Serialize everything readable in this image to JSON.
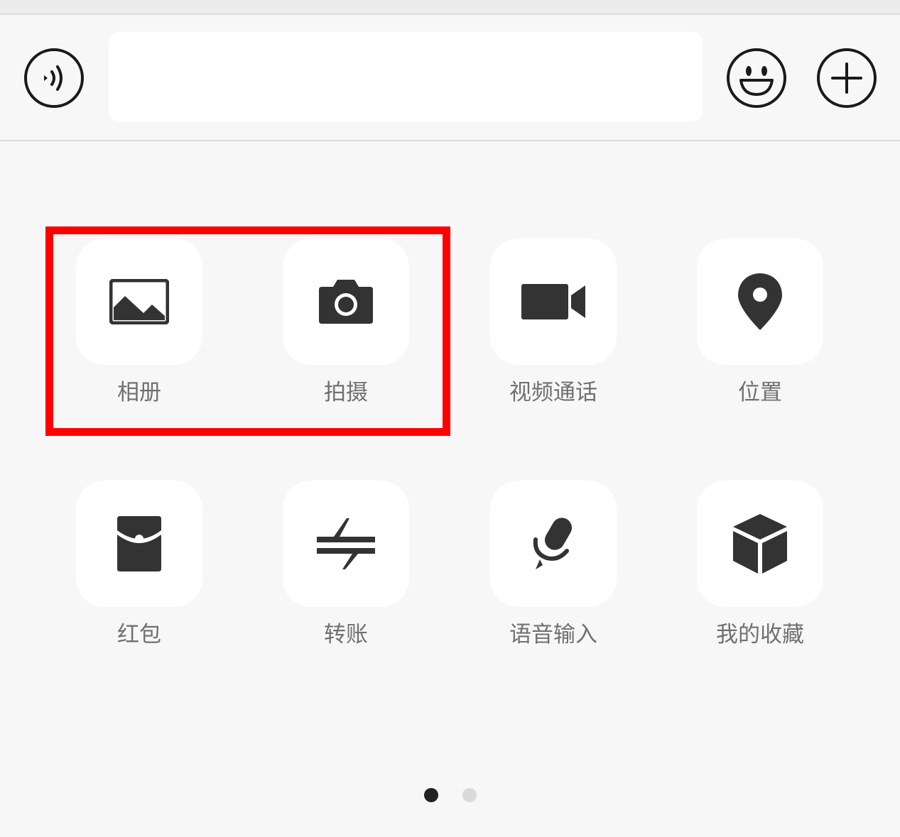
{
  "input_bar": {
    "text_value": "",
    "voice_icon": "voice-wave-icon",
    "emoji_icon": "smiley-face-icon",
    "more_icon": "plus-circle-icon"
  },
  "panel": {
    "tiles": [
      {
        "label": "相册",
        "icon": "image-icon"
      },
      {
        "label": "拍摄",
        "icon": "camera-icon"
      },
      {
        "label": "视频通话",
        "icon": "video-camera-icon"
      },
      {
        "label": "位置",
        "icon": "location-pin-icon"
      },
      {
        "label": "红包",
        "icon": "red-envelope-icon"
      },
      {
        "label": "转账",
        "icon": "transfer-arrows-icon"
      },
      {
        "label": "语音输入",
        "icon": "microphone-icon"
      },
      {
        "label": "我的收藏",
        "icon": "cube-icon"
      }
    ]
  },
  "pager": {
    "page_count": 2,
    "active_page": 1
  },
  "colors": {
    "background": "#f7f7f7",
    "tile_background": "#ffffff",
    "icon": "#333333",
    "label": "#707070",
    "highlight": "#ff0000"
  }
}
